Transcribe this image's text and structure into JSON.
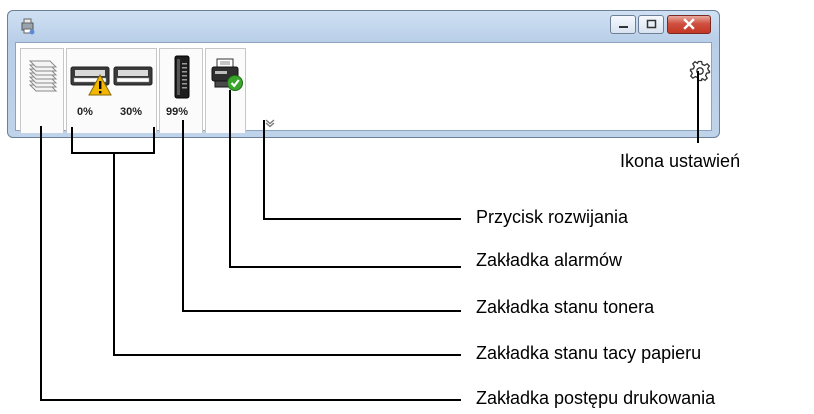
{
  "window": {
    "title": "",
    "buttons": {
      "minimize_icon": "minimize-icon",
      "maximize_icon": "maximize-icon",
      "close_icon": "close-icon"
    }
  },
  "tabs": {
    "print_progress": {
      "icon": "document-stack-icon"
    },
    "paper_tray": {
      "tray1_percent": "0%",
      "tray2_percent": "30%",
      "icons": [
        "paper-tray-warning-icon",
        "paper-tray-icon"
      ]
    },
    "toner": {
      "percent": "99%",
      "icon": "toner-cartridge-icon"
    },
    "alarm": {
      "icon": "printer-ok-icon"
    }
  },
  "expand_icon": "chevron-down-icon",
  "settings_icon": "gear-icon",
  "callouts": {
    "settings_icon": "Ikona ustawień",
    "expand_button": "Przycisk rozwijania",
    "alarm_tab": "Zakładka alarmów",
    "toner_tab": "Zakładka stanu tonera",
    "paper_tray_tab": "Zakładka stanu tacy papieru",
    "print_progress_tab": "Zakładka postępu drukowania"
  },
  "colors": {
    "window_border": "#6b7f99",
    "close_button": "#c33624",
    "warning": "#f2b705",
    "ok_badge": "#3aa52b"
  }
}
